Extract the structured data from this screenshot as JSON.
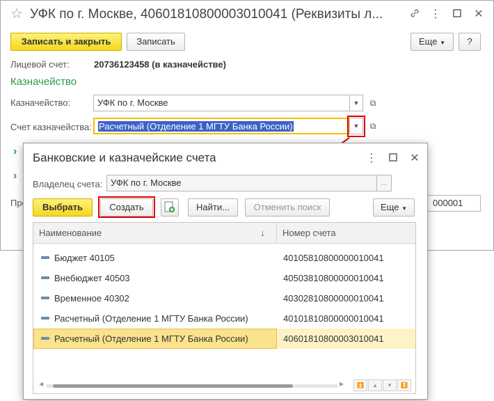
{
  "back_window": {
    "title": "УФК по г. Москве, 40601810800003010041 (Реквизиты л...",
    "toolbar": {
      "save_close": "Записать и закрыть",
      "save": "Записать",
      "more": "Еще"
    },
    "account_label": "Лицевой счет:",
    "account_value": "20736123458 (в казначействе)",
    "section_title": "Казначейство",
    "treasury_label": "Казначейство:",
    "treasury_value": "УФК по г. Москве",
    "treasury_account_label": "Счет казначейства:",
    "treasury_account_value": "Расчетный (Отделение 1 МГТУ Банка России)",
    "hidden_label_prefix": "Пре",
    "hidden_value_suffix": "000001"
  },
  "dialog": {
    "title": "Банковские и казначейские счета",
    "owner_label": "Владелец счета:",
    "owner_value": "УФК по г. Москве",
    "owner_ellipsis": "...",
    "toolbar": {
      "select": "Выбрать",
      "create": "Создать",
      "find": "Найти...",
      "cancel_search": "Отменить поиск",
      "more": "Еще"
    },
    "columns": [
      "Наименование",
      "Номер счета"
    ],
    "sort_indicator": "↓",
    "rows": [
      {
        "name": "Бюджет 40105",
        "number": "40105810800000010041"
      },
      {
        "name": "Внебюджет 40503",
        "number": "40503810800000010041"
      },
      {
        "name": "Временное 40302",
        "number": "40302810800000010041"
      },
      {
        "name": "Расчетный (Отделение 1 МГТУ Банка России)",
        "number": "40101810800000010041"
      },
      {
        "name": "Расчетный (Отделение 1 МГТУ Банка России)",
        "number": "40601810800003010041"
      }
    ],
    "selected_row": 4
  },
  "colors": {
    "accent_yellow": "#f3d81e",
    "section_green": "#2c9a44",
    "highlight_red": "#e00000",
    "selection_blue": "#3c62c7",
    "selected_row": "#fbe28c"
  },
  "icons": [
    "star-icon",
    "link-icon",
    "minimize-icon",
    "maximize-icon",
    "close-icon",
    "dropdown-arrow-icon",
    "open-form-icon",
    "chevron-right-icon",
    "add-copy-icon",
    "sort-down-icon",
    "row-item-icon",
    "red-arrow-icon"
  ]
}
